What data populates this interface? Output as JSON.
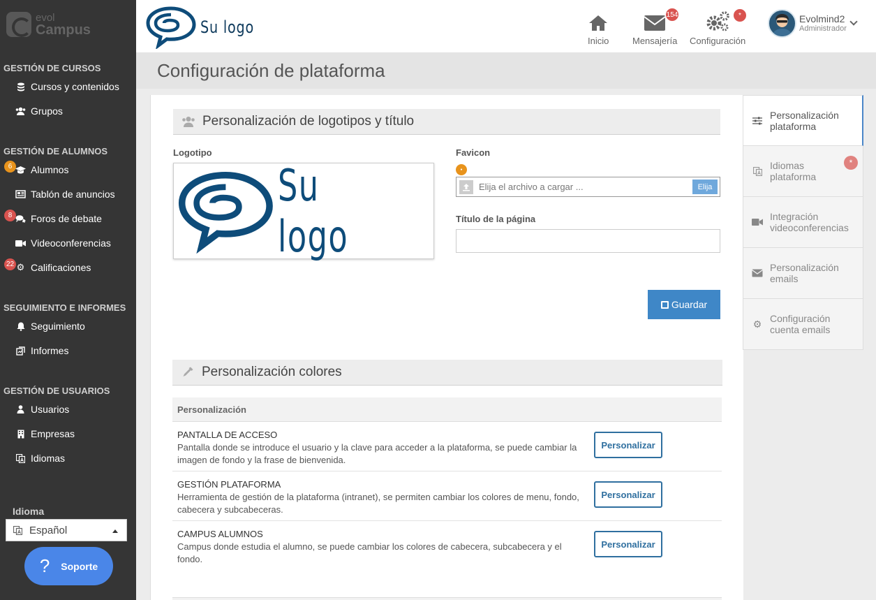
{
  "brand": {
    "line1": "evol",
    "line2": "Campus"
  },
  "sidebar": {
    "sections": [
      {
        "title": "GESTIÓN DE CURSOS",
        "items": [
          {
            "label": "Cursos y contenidos",
            "icon": "database-icon"
          },
          {
            "label": "Grupos",
            "icon": "users-icon"
          }
        ]
      },
      {
        "title": "GESTIÓN DE ALUMNOS",
        "items": [
          {
            "label": "Alumnos",
            "icon": "graduation-cap-icon",
            "badge": "6"
          },
          {
            "label": "Tablón de anuncios",
            "icon": "newspaper-icon"
          },
          {
            "label": "Foros de debate",
            "icon": "comments-icon",
            "badge": "8"
          },
          {
            "label": "Videoconferencias",
            "icon": "video-camera-icon"
          },
          {
            "label": "Calificaciones",
            "icon": "gear-icon",
            "badge": "22"
          }
        ]
      },
      {
        "title": "SEGUIMIENTO E INFORMES",
        "items": [
          {
            "label": "Seguimiento",
            "icon": "bell-icon"
          },
          {
            "label": "Informes",
            "icon": "report-icon"
          }
        ]
      },
      {
        "title": "GESTIÓN DE USUARIOS",
        "items": [
          {
            "label": "Usuarios",
            "icon": "user-icon"
          },
          {
            "label": "Empresas",
            "icon": "building-icon"
          },
          {
            "label": "Idiomas",
            "icon": "translate-icon"
          }
        ]
      }
    ],
    "language_label": "Idioma",
    "language_value": "Español",
    "support_label": "Soporte"
  },
  "header": {
    "logo_text": "Su logo",
    "nav": [
      {
        "label": "Inicio",
        "icon": "home-icon"
      },
      {
        "label": "Mensajería",
        "icon": "envelope-icon",
        "badge": "154"
      },
      {
        "label": "Configuración",
        "icon": "gears-icon",
        "badge": "*"
      }
    ],
    "user_name": "Evolmind2",
    "user_role": "Administrador"
  },
  "page": {
    "title": "Configuración de plataforma"
  },
  "logos_section": {
    "title": "Personalización de logotipos y título",
    "logo_label": "Logotipo",
    "logo_text": "Su logo",
    "favicon_label": "Favicon",
    "file_placeholder": "Elija el archivo a cargar ...",
    "file_button": "Elija",
    "page_title_label": "Título de la página",
    "page_title_value": "",
    "save_label": "Guardar"
  },
  "colors_section": {
    "title": "Personalización colores",
    "table_header": "Personalización",
    "rows": [
      {
        "title": "PANTALLA DE ACCESO",
        "desc": "Pantalla donde se introduce el usuario y la clave para acceder a la plataforma, se puede cambiar la imagen de fondo y la frase de bienvenida.",
        "button": "Personalizar"
      },
      {
        "title": "GESTIÓN PLATAFORMA",
        "desc": "Herramienta de gestión de la plataforma (intranet), se permiten cambiar los colores de menu, fondo, cabecera y subcabeceras.",
        "button": "Personalizar"
      },
      {
        "title": "CAMPUS ALUMNOS",
        "desc": "Campus donde estudia el alumno, se puede cambiar los colores de cabecera, subcabecera y el fondo.",
        "button": "Personalizar"
      }
    ]
  },
  "right_tabs": [
    {
      "line1": "Personalización",
      "line2": "plataforma",
      "icon": "sliders-icon",
      "active": true
    },
    {
      "line1": "Idiomas",
      "line2": "plataforma",
      "icon": "translate-icon",
      "badge": "*"
    },
    {
      "line1": "Integración",
      "line2": "videoconferencias",
      "icon": "video-camera-icon"
    },
    {
      "line1": "Personalización",
      "line2": "emails",
      "icon": "envelope-icon"
    },
    {
      "line1": "Configuración",
      "line2": "cuenta emails",
      "icon": "gear-icon"
    }
  ],
  "colors": {
    "sidebar_bg": "#353535",
    "accent": "#3f87c7",
    "badge_red": "#d9534f",
    "badge_orange": "#e8931c"
  }
}
